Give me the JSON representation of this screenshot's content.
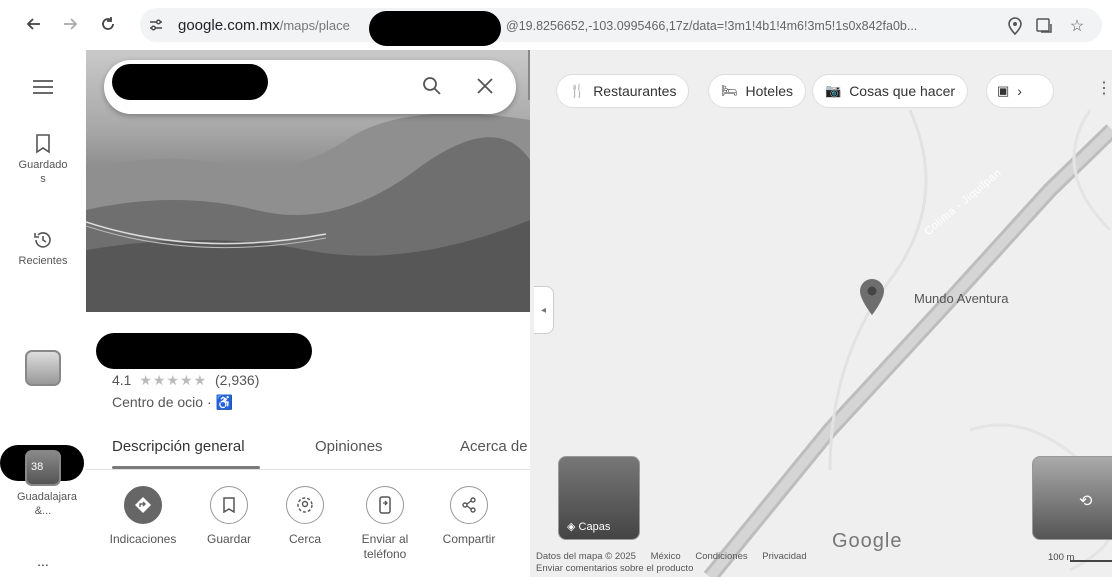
{
  "browser": {
    "url_host": "google.com.mx",
    "url_path": "/maps/place",
    "url_tail": "@19.8256652,-103.0995466,17z/data=!3m1!4b1!4m6!3m5!1s0x842fa0b...",
    "icons": [
      "back-arrow-icon",
      "forward-arrow-icon",
      "reload-icon",
      "site-settings-icon",
      "location-icon",
      "install-app-icon",
      "bookmark-star-icon"
    ]
  },
  "rail": {
    "menu_icon": "hamburger-icon",
    "saved_label": "Guardados",
    "recent_label": "Recientes",
    "more_label": "...",
    "collection_badge": "38",
    "collection_label": "Guadalajara &..."
  },
  "place": {
    "rating": "4.1",
    "stars": "★★★★★",
    "review_count": "(2,936)",
    "category": "Centro de ocio · ♿",
    "tabs": [
      {
        "label": "Descripción general",
        "active": true
      },
      {
        "label": "Opiniones"
      },
      {
        "label": "Acerca de"
      }
    ],
    "actions": [
      {
        "label": "Indicaciones",
        "icon": "directions-icon"
      },
      {
        "label": "Guardar",
        "icon": "bookmark-icon"
      },
      {
        "label": "Cerca",
        "icon": "nearby-icon"
      },
      {
        "label": "Enviar al teléfono",
        "icon": "send-to-phone-icon"
      },
      {
        "label": "Compartir",
        "icon": "share-icon"
      }
    ]
  },
  "map": {
    "chips": [
      {
        "label": "Restaurantes",
        "icon": "restaurant-icon"
      },
      {
        "label": "Hoteles",
        "icon": "hotel-icon"
      },
      {
        "label": "Cosas que hacer",
        "icon": "camera-icon"
      }
    ],
    "road_label": "Colima - Jiquilpan",
    "pin_label": "Mundo Aventura",
    "layers_label": "Capas",
    "google_wordmark": "Google",
    "footer": {
      "map_data": "Datos del mapa © 2025",
      "country": "México",
      "terms": "Condiciones",
      "privacy": "Privacidad",
      "feedback": "Enviar comentarios sobre el producto"
    },
    "scale": "100 m"
  }
}
